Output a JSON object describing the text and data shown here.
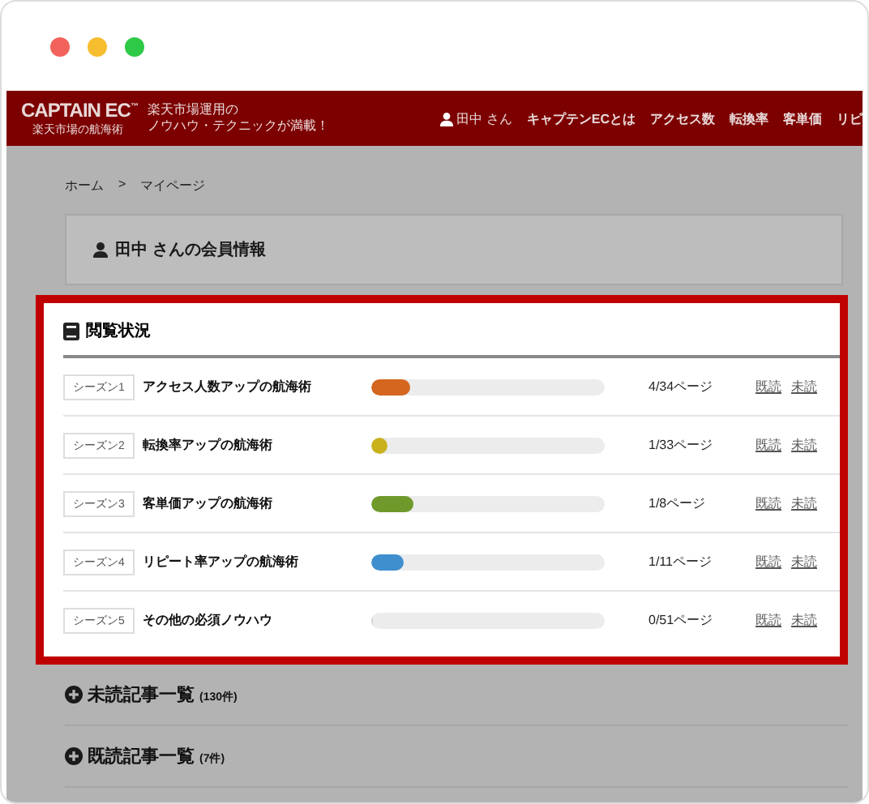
{
  "header": {
    "logo": "CAPTAIN EC$^{™}$",
    "logo_sub": "楽天市場の航海術",
    "tagline": [
      "楽天市場運用の",
      "ノウハウ・テクニックが満載！"
    ],
    "user": "田中 さん",
    "nav": [
      "キャプテンECとは",
      "アクセス数",
      "転換率",
      "客単価",
      "リピ"
    ]
  },
  "breadcrumb": {
    "items": [
      "ホーム",
      "マイページ"
    ],
    "separator": ">"
  },
  "member_card": {
    "title": "田中 さんの会員情報"
  },
  "reading_status": {
    "title": "閲覧状況",
    "rows": [
      {
        "season": "シーズン1",
        "title": "アクセス人数アップの航海術",
        "level": 0.17,
        "color": "#d4661f",
        "pages": "4/34ページ",
        "links": [
          "既読",
          "未読"
        ]
      },
      {
        "season": "シーズン2",
        "title": "転換率アップの航海術",
        "level": 0.07,
        "color": "#c9b11c",
        "pages": "1/33ページ",
        "links": [
          "既読",
          "未読"
        ]
      },
      {
        "season": "シーズン3",
        "title": "客単価アップの航海術",
        "level": 0.18,
        "color": "#6f9a2b",
        "pages": "1/8ページ",
        "links": [
          "既読",
          "未読"
        ]
      },
      {
        "season": "シーズン4",
        "title": "リピート率アップの航海術",
        "level": 0.14,
        "color": "#3f8fcf",
        "pages": "1/11ページ",
        "links": [
          "既読",
          "未読"
        ]
      },
      {
        "season": "シーズン5",
        "title": "その他の必須ノウハウ",
        "level": 0,
        "pages": "0/51ページ",
        "links": [
          "既読",
          "未読"
        ]
      }
    ]
  },
  "sections": [
    {
      "title": "未読記事一覧",
      "count": "(130件)"
    },
    {
      "title": "既読記事一覧",
      "count": "(7件)"
    }
  ]
}
